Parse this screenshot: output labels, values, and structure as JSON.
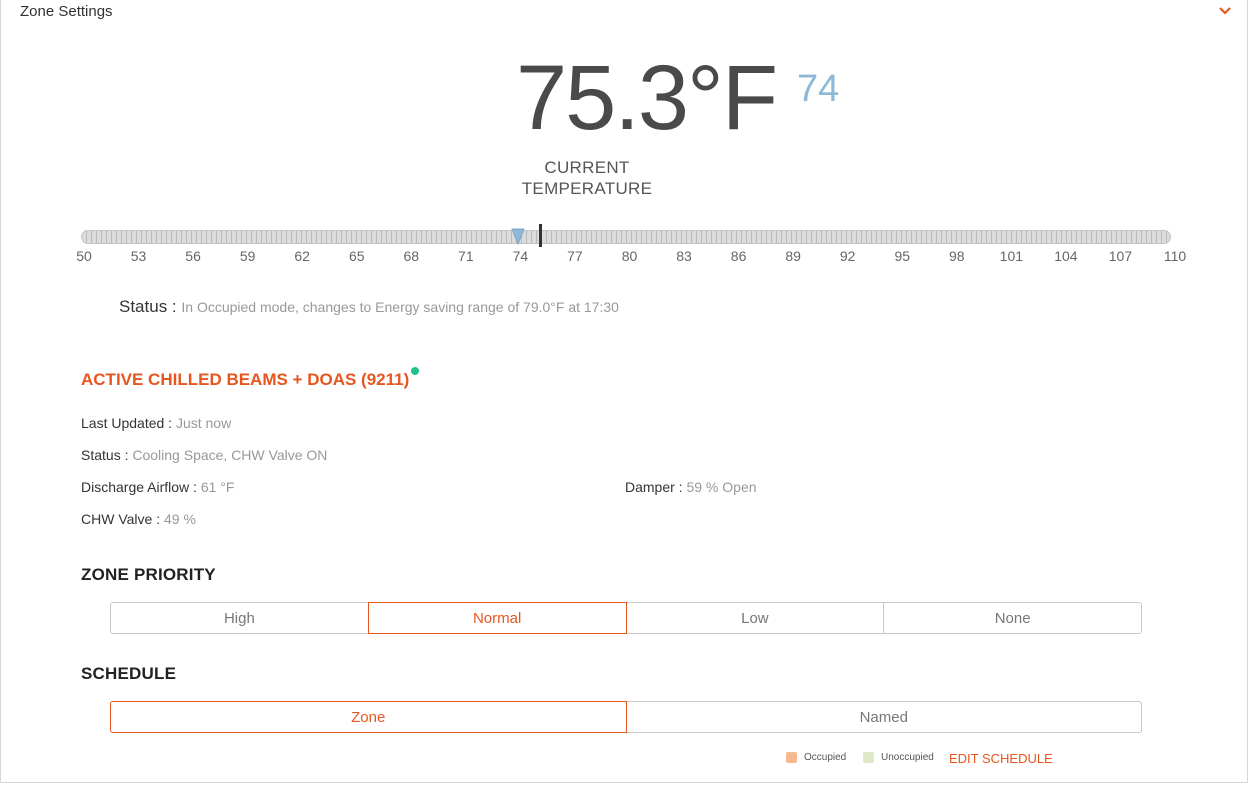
{
  "header": {
    "title": "Zone Settings",
    "collapse_icon": "chevron-down-icon"
  },
  "temperature": {
    "current": "75.3°F",
    "setpoint": "74",
    "caption_line1": "CURRENT",
    "caption_line2": "TEMPERATURE",
    "range_min": 50,
    "range_max": 110,
    "setpoint_value": 74,
    "current_value": 75.3,
    "ticks": [
      "50",
      "53",
      "56",
      "59",
      "62",
      "65",
      "68",
      "71",
      "74",
      "77",
      "80",
      "83",
      "86",
      "89",
      "92",
      "95",
      "98",
      "101",
      "104",
      "107",
      "110"
    ]
  },
  "status": {
    "label": "Status :",
    "value": "In Occupied mode, changes to Energy saving range of 79.0°F at 17:30"
  },
  "equipment": {
    "title": "ACTIVE CHILLED BEAMS + DOAS (9211)",
    "online_color": "#22c286",
    "last_updated_label": "Last Updated :",
    "last_updated_value": "Just now",
    "status_label": "Status :",
    "status_value": "Cooling Space, CHW Valve ON",
    "discharge_label": "Discharge Airflow :",
    "discharge_value": "61 °F",
    "damper_label": "Damper :",
    "damper_value": "59 % Open",
    "chw_label": "CHW Valve :",
    "chw_value": "49 %"
  },
  "zone_priority": {
    "title": "ZONE PRIORITY",
    "options": [
      "High",
      "Normal",
      "Low",
      "None"
    ],
    "selected": "Normal"
  },
  "schedule": {
    "title": "SCHEDULE",
    "options": [
      "Zone",
      "Named"
    ],
    "selected": "Zone",
    "legend_occupied": "Occupied",
    "legend_unoccupied": "Unoccupied",
    "occupied_color": "#f6b98e",
    "unoccupied_color": "#dfe9c8",
    "edit_label": "EDIT SCHEDULE"
  },
  "colors": {
    "accent": "#e8561f",
    "setpoint": "#8eb9d6"
  }
}
